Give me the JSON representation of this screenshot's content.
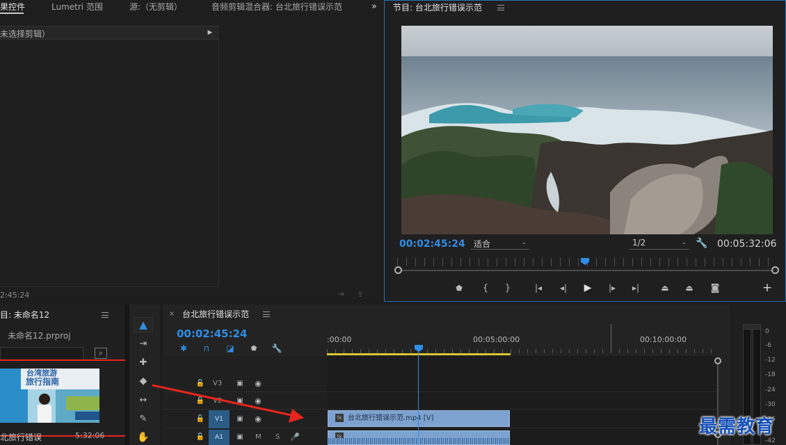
{
  "tabs": {
    "effect_controls": "果控件",
    "lumetri": "Lumetri 范围",
    "source": "源:（无剪辑）",
    "audio_mixer": "音频剪辑混合器: 台北旅行错误示范",
    "program": "节目: 台北旅行错误示范"
  },
  "effect_controls": {
    "no_clip_text": "未选择剪辑）",
    "timecode": "2:45:24"
  },
  "program_monitor": {
    "current_time": "00:02:45:24",
    "fit_label": "适合",
    "resolution_label": "1/2",
    "duration": "00:05:32:06"
  },
  "project_panel": {
    "title": "目: 未命名12",
    "file_name": "未命名12.prproj",
    "clip_thumb_text_1": "台湾旅游",
    "clip_thumb_text_2": "旅行指南",
    "clip_name": "北旅行错误",
    "clip_duration": "5:32:06"
  },
  "timeline": {
    "title": "台北旅行错误示范",
    "timecode": "00:02:45:24",
    "ruler": [
      ":00:00",
      "00:05:00:00",
      "00:10:00:00"
    ],
    "tracks": [
      {
        "name": "V3"
      },
      {
        "name": "V2"
      },
      {
        "name": "V1"
      },
      {
        "name": "A1"
      }
    ],
    "video_clip_name": "台北旅行错误示范.mp4 [V]",
    "audio_buttons": {
      "mute": "M",
      "solo": "S"
    }
  },
  "meters": {
    "scale": [
      "0",
      "-6",
      "-12",
      "-18",
      "-24",
      "-30",
      "-36",
      "-42"
    ]
  },
  "watermark": "最需教育",
  "colors": {
    "accent": "#2f8ee5",
    "clip": "#7da2cf",
    "annotation": "#e6251c",
    "work_area": "#d6c632"
  }
}
